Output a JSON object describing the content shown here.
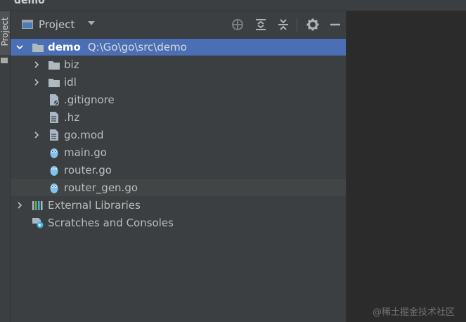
{
  "window": {
    "title": "demo"
  },
  "tool_window": {
    "stripe_label": "Project",
    "view_selector": "Project"
  },
  "toolbar": {
    "icons": [
      "locate-icon",
      "expand-all-icon",
      "collapse-all-icon",
      "settings-icon",
      "hide-icon"
    ]
  },
  "tree": {
    "root": {
      "name": "demo",
      "path": "Q:\\Go\\go\\src\\demo"
    },
    "children": [
      {
        "name": "biz",
        "type": "folder"
      },
      {
        "name": "idl",
        "type": "folder"
      },
      {
        "name": ".gitignore",
        "type": "ignore-file"
      },
      {
        "name": ".hz",
        "type": "file"
      },
      {
        "name": "go.mod",
        "type": "go-mod-file"
      },
      {
        "name": "main.go",
        "type": "go-file"
      },
      {
        "name": "router.go",
        "type": "go-file"
      },
      {
        "name": "router_gen.go",
        "type": "go-file"
      }
    ],
    "external_libraries": "External Libraries",
    "scratches": "Scratches and Consoles"
  },
  "watermark": "@稀土掘金技术社区",
  "colors": {
    "selection": "#4a6fb5",
    "panel_bg": "#3c3f41",
    "editor_bg": "#2b2b2b",
    "text": "#bbbbbb"
  }
}
